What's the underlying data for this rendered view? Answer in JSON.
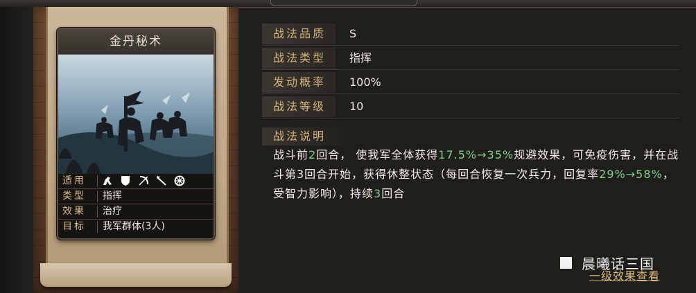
{
  "card": {
    "title": "金丹秘术",
    "attributes": {
      "suitable_label": "适用",
      "unit_icons": [
        "cavalry-icon",
        "shield-icon",
        "bow-icon",
        "spear-icon",
        "siege-wheel-icon"
      ],
      "type_label": "类型",
      "type_value": "指挥",
      "effect_label": "效果",
      "effect_value": "治疗",
      "target_label": "目标",
      "target_value": "我军群体(3人)"
    }
  },
  "info": [
    {
      "label": "战法品质",
      "value": "S"
    },
    {
      "label": "战法类型",
      "value": "指挥"
    },
    {
      "label": "发动概率",
      "value": "100%"
    },
    {
      "label": "战法等级",
      "value": "10"
    }
  ],
  "description": {
    "label": "战法说明",
    "segments": [
      {
        "t": "战斗前",
        "hl": false
      },
      {
        "t": "2",
        "hl": true
      },
      {
        "t": "回合， 使我军全体获得",
        "hl": false
      },
      {
        "t": "17.5%→35%",
        "hl": true
      },
      {
        "t": "规避效果，可免疫伤害，并在战斗第3回合开始，获得休整状态（每回合恢复一次兵力，回复率",
        "hl": false
      },
      {
        "t": "29%→58%",
        "hl": true
      },
      {
        "t": "，受智力影响），持续",
        "hl": false
      },
      {
        "t": "3",
        "hl": true
      },
      {
        "t": "回合",
        "hl": false
      }
    ]
  },
  "watermark": "晨曦话三国",
  "detail_link": "一级效果查看",
  "colors": {
    "highlight": "#7fd08a",
    "label_gold": "#d6b37a"
  }
}
